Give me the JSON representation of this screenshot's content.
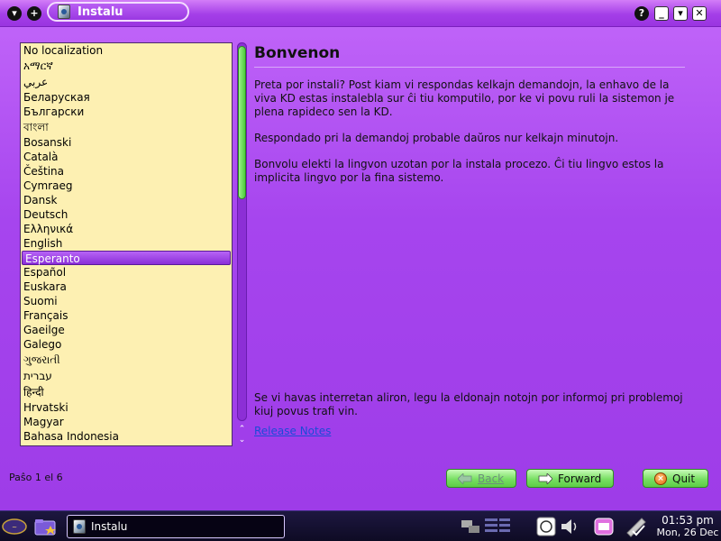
{
  "window": {
    "title": "Instalu",
    "colors": {
      "accent": "#b34ef4",
      "list_bg": "#fdf0b2",
      "button_green": "#78df63",
      "link": "#1a4bd8"
    }
  },
  "languages": [
    "No localization",
    "አማርኛ",
    "عربي",
    "Беларуская",
    "Български",
    "বাংলা",
    "Bosanski",
    "Català",
    "Čeština",
    "Cymraeg",
    "Dansk",
    "Deutsch",
    "Ελληνικά",
    "English",
    "Esperanto",
    "Español",
    "Euskara",
    "Suomi",
    "Français",
    "Gaeilge",
    "Galego",
    "ગુજરાતી",
    "עברית",
    "हिन्दी",
    "Hrvatski",
    "Magyar",
    "Bahasa Indonesia"
  ],
  "selected_language": "Esperanto",
  "content": {
    "heading": "Bonvenon",
    "para1": "Preta por instali? Post kiam vi respondas kelkajn demandojn, la enhavo de la viva KD estas instalebla sur ĉi tiu komputilo, por ke vi povu ruli la sistemon je plena rapideco sen la KD.",
    "para2": "Respondado pri la demandoj probable daŭros nur kelkajn minutojn.",
    "para3": "Bonvolu elekti la lingvon uzotan por la instala procezo. Ĉi tiu lingvo estos la implicita lingvo por la fina sistemo.",
    "bottom_note": "Se vi havas interretan aliron, legu la eldonajn notojn por informoj pri problemoj kiuj povus trafi vin.",
    "release_notes": "Release Notes"
  },
  "footer": {
    "step": "Paŝo 1 el 6",
    "back": "Back",
    "forward": "Forward",
    "quit": "Quit"
  },
  "taskbar": {
    "task_label": "Instalu",
    "time": "01:53 pm",
    "date": "Mon, 26 Dec"
  }
}
